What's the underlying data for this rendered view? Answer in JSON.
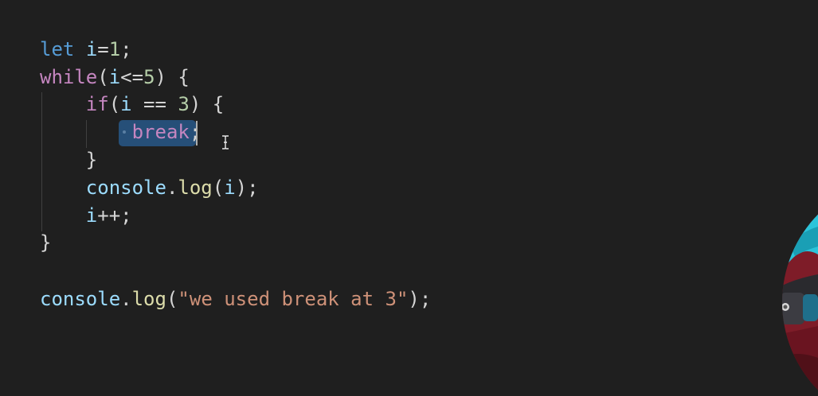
{
  "editor": {
    "lines": [
      [
        {
          "t": "let",
          "c": "kw"
        },
        {
          "t": " ",
          "c": "op"
        },
        {
          "t": "i",
          "c": "var"
        },
        {
          "t": "=",
          "c": "op"
        },
        {
          "t": "1",
          "c": "num"
        },
        {
          "t": ";",
          "c": "punc"
        }
      ],
      [
        {
          "t": "while",
          "c": "ctrl"
        },
        {
          "t": "(",
          "c": "brace"
        },
        {
          "t": "i",
          "c": "var"
        },
        {
          "t": "<=",
          "c": "op"
        },
        {
          "t": "5",
          "c": "num"
        },
        {
          "t": ")",
          "c": "brace"
        },
        {
          "t": " {",
          "c": "brace"
        }
      ],
      [
        {
          "t": "    ",
          "c": "op"
        },
        {
          "t": "if",
          "c": "ctrl"
        },
        {
          "t": "(",
          "c": "brace"
        },
        {
          "t": "i",
          "c": "var"
        },
        {
          "t": " == ",
          "c": "op"
        },
        {
          "t": "3",
          "c": "num"
        },
        {
          "t": ")",
          "c": "brace"
        },
        {
          "t": " {",
          "c": "brace"
        }
      ],
      [
        {
          "t": "        ",
          "c": "op"
        },
        {
          "t": "break",
          "c": "ctrl"
        },
        {
          "t": ";",
          "c": "punc"
        }
      ],
      [
        {
          "t": "    ",
          "c": "op"
        },
        {
          "t": "}",
          "c": "brace"
        }
      ],
      [
        {
          "t": "    ",
          "c": "op"
        },
        {
          "t": "console",
          "c": "var"
        },
        {
          "t": ".",
          "c": "punc"
        },
        {
          "t": "log",
          "c": "fn"
        },
        {
          "t": "(",
          "c": "brace"
        },
        {
          "t": "i",
          "c": "var"
        },
        {
          "t": ")",
          "c": "brace"
        },
        {
          "t": ";",
          "c": "punc"
        }
      ],
      [
        {
          "t": "    ",
          "c": "op"
        },
        {
          "t": "i",
          "c": "var"
        },
        {
          "t": "++",
          "c": "op"
        },
        {
          "t": ";",
          "c": "punc"
        }
      ],
      [
        {
          "t": "}",
          "c": "brace"
        }
      ],
      [],
      [
        {
          "t": "console",
          "c": "var"
        },
        {
          "t": ".",
          "c": "punc"
        },
        {
          "t": "log",
          "c": "fn"
        },
        {
          "t": "(",
          "c": "brace"
        },
        {
          "t": "\"we used break at 3\"",
          "c": "str"
        },
        {
          "t": ")",
          "c": "brace"
        },
        {
          "t": ";",
          "c": "punc"
        }
      ]
    ],
    "selected_text": "break;"
  },
  "colors": {
    "background": "#1f1f1f",
    "keyword": "#569cd6",
    "control": "#c586c0",
    "variable": "#9cdcfe",
    "number": "#b5cea8",
    "function": "#dcdcaa",
    "string": "#ce9178",
    "selection": "#264f78"
  }
}
